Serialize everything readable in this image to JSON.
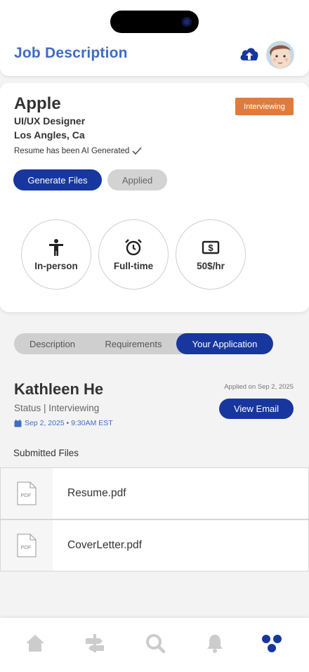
{
  "header": {
    "title": "Job Description",
    "upload_icon": "cloud-upload-icon",
    "avatar_icon": "user-avatar"
  },
  "job": {
    "company": "Apple",
    "role": "UI/UX Designer",
    "location": "Los Angles, Ca",
    "status_badge": "Interviewing",
    "ai_note": "Resume has been AI Generated",
    "generate_label": "Generate Files",
    "applied_label": "Applied",
    "features": [
      {
        "icon": "person-icon",
        "label": "In-person"
      },
      {
        "icon": "alarm-clock-icon",
        "label": "Full-time"
      },
      {
        "icon": "dollar-bill-icon",
        "label": "50$/hr"
      }
    ]
  },
  "tabs": [
    {
      "label": "Description",
      "active": false
    },
    {
      "label": "Requirements",
      "active": false
    },
    {
      "label": "Your Application",
      "active": true
    }
  ],
  "application": {
    "name": "Kathleen He",
    "status": "Status | Interviewing",
    "datetime": "Sep 2, 2025 • 9:30AM EST",
    "applied_on": "Applied on Sep 2, 2025",
    "view_email_label": "View Email",
    "submitted_title": "Submitted Files",
    "files": [
      {
        "icon": "pdf-file-icon",
        "type_label": "PDF",
        "name": "Resume.pdf"
      },
      {
        "icon": "pdf-file-icon",
        "type_label": "PDF",
        "name": "CoverLetter.pdf"
      }
    ]
  },
  "nav": [
    {
      "icon": "home-icon",
      "active": false
    },
    {
      "icon": "signpost-icon",
      "active": false
    },
    {
      "icon": "search-icon",
      "active": false
    },
    {
      "icon": "bell-icon",
      "active": false
    },
    {
      "icon": "profile-dots-icon",
      "active": true
    }
  ],
  "colors": {
    "accent": "#17379e",
    "title_blue": "#3f6cc4",
    "status_orange": "#e07b3c",
    "nav_inactive": "#cccccc"
  }
}
